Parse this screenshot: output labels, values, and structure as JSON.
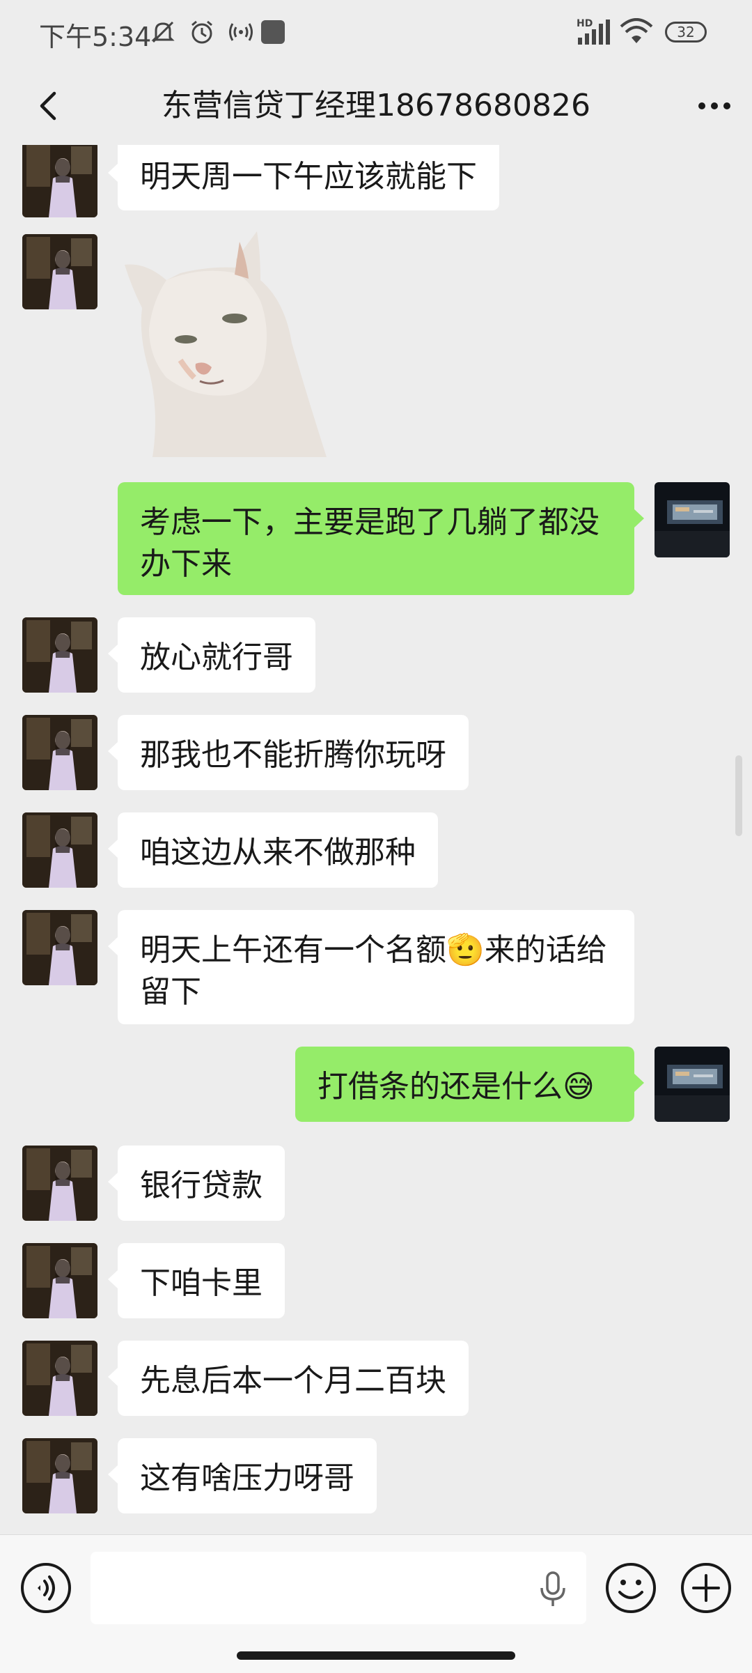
{
  "status_bar": {
    "time": "下午5:34",
    "battery": "32",
    "network": "HD"
  },
  "header": {
    "title": "东营信贷丁经理18678680826"
  },
  "messages": [
    {
      "side": "left",
      "text": "明天周一下午应该就能下"
    },
    {
      "side": "left",
      "type": "sticker",
      "icon": "cat-sticker"
    },
    {
      "side": "right",
      "text": "考虑一下，主要是跑了几躺了都没办下来"
    },
    {
      "side": "left",
      "text": "放心就行哥"
    },
    {
      "side": "left",
      "text": "那我也不能折腾你玩呀"
    },
    {
      "side": "left",
      "text": "咱这边从来不做那种"
    },
    {
      "side": "left",
      "text": "明天上午还有一个名额🫡来的话给留下"
    },
    {
      "side": "right",
      "text": "打借条的还是什么😅"
    },
    {
      "side": "left",
      "text": "银行贷款"
    },
    {
      "side": "left",
      "text": "下咱卡里"
    },
    {
      "side": "left",
      "text": "先息后本一个月二百块"
    },
    {
      "side": "left",
      "text": "这有啥压力呀哥"
    }
  ],
  "input": {
    "placeholder": ""
  },
  "colors": {
    "chat_bg": "#ededed",
    "sent_bubble": "#95ec69",
    "received_bubble": "#ffffff"
  }
}
